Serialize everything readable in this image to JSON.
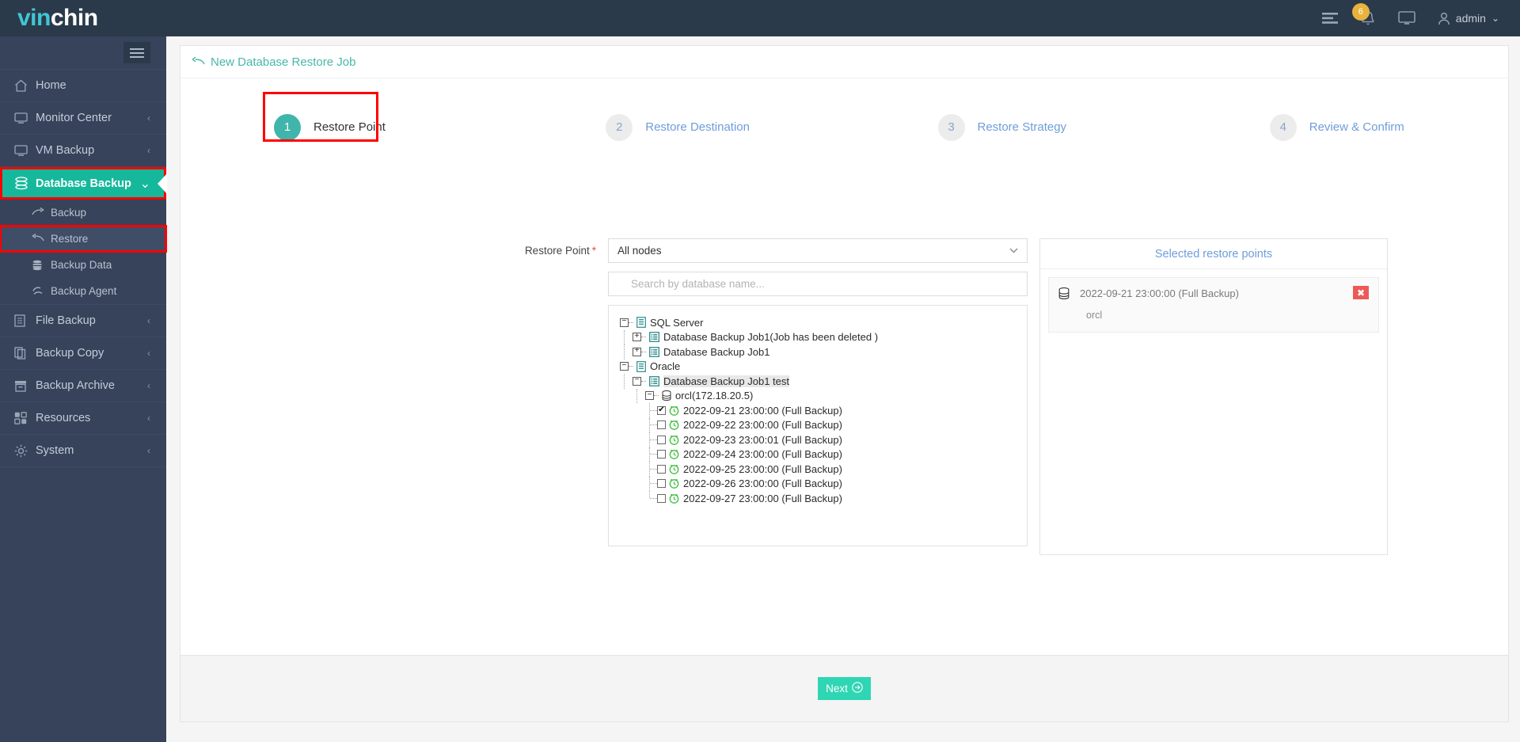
{
  "brand": {
    "part1": "vin",
    "part2": "chin"
  },
  "topbar": {
    "list_icon": "list-icon",
    "notifications_count": "6",
    "bell_icon": "bell-icon",
    "monitor_icon": "monitor-icon",
    "user_icon": "user-icon",
    "username": "admin",
    "caret": "⌄"
  },
  "sidebar": {
    "collapse_icon": "hamburger-icon",
    "items": [
      {
        "label": "Home",
        "icon": "home-icon",
        "chevron": ""
      },
      {
        "label": "Monitor Center",
        "icon": "monitor-icon",
        "chevron": "‹"
      },
      {
        "label": "VM Backup",
        "icon": "display-icon",
        "chevron": "‹"
      },
      {
        "label": "Database Backup",
        "icon": "database-icon",
        "chevron": "⌄"
      },
      {
        "label": "File Backup",
        "icon": "file-icon",
        "chevron": "‹"
      },
      {
        "label": "Backup Copy",
        "icon": "copy-icon",
        "chevron": "‹"
      },
      {
        "label": "Backup Archive",
        "icon": "archive-icon",
        "chevron": "‹"
      },
      {
        "label": "Resources",
        "icon": "grid-icon",
        "chevron": "‹"
      },
      {
        "label": "System",
        "icon": "gear-icon",
        "chevron": "‹"
      }
    ],
    "subitems": [
      {
        "label": "Backup",
        "icon": "backup-arrow-icon"
      },
      {
        "label": "Restore",
        "icon": "restore-arrow-icon"
      },
      {
        "label": "Backup Data",
        "icon": "database-stack-icon"
      },
      {
        "label": "Backup Agent",
        "icon": "agent-icon"
      }
    ]
  },
  "breadcrumb": {
    "back_icon": "back-arrow-icon",
    "title": "New Database Restore Job"
  },
  "steps": [
    {
      "num": "1",
      "label": "Restore Point"
    },
    {
      "num": "2",
      "label": "Restore Destination"
    },
    {
      "num": "3",
      "label": "Restore Strategy"
    },
    {
      "num": "4",
      "label": "Review & Confirm"
    }
  ],
  "form": {
    "restore_point_label": "Restore Point",
    "required_mark": "*",
    "node_select_value": "All nodes",
    "node_select_chevron": "⌄",
    "search_placeholder": "Search by database name...",
    "search_value": ""
  },
  "tree": [
    {
      "depth": 0,
      "toggler": "−",
      "icon": "server-icon",
      "label": "SQL Server",
      "checkbox": false,
      "highlight": false
    },
    {
      "depth": 1,
      "toggler": "+",
      "icon": "job-list-icon",
      "label": "Database Backup Job1(Job has been deleted )",
      "checkbox": false,
      "highlight": false
    },
    {
      "depth": 1,
      "toggler": "+",
      "icon": "job-list-icon",
      "label": "Database Backup Job1",
      "checkbox": false,
      "highlight": false
    },
    {
      "depth": 0,
      "toggler": "−",
      "icon": "server-icon",
      "label": "Oracle",
      "checkbox": false,
      "highlight": false
    },
    {
      "depth": 1,
      "toggler": "−",
      "icon": "job-list-icon",
      "label": "Database Backup Job1 test",
      "checkbox": false,
      "highlight": true
    },
    {
      "depth": 2,
      "toggler": "−",
      "icon": "database-icon",
      "label": "orcl(172.18.20.5)",
      "checkbox": false,
      "highlight": false
    },
    {
      "depth": 3,
      "toggler": null,
      "icon": "clock-icon",
      "label": "2022-09-21 23:00:00 (Full Backup)",
      "checkbox": true,
      "checked": true,
      "highlight": false
    },
    {
      "depth": 3,
      "toggler": null,
      "icon": "clock-icon",
      "label": "2022-09-22 23:00:00 (Full Backup)",
      "checkbox": true,
      "checked": false,
      "highlight": false
    },
    {
      "depth": 3,
      "toggler": null,
      "icon": "clock-icon",
      "label": "2022-09-23 23:00:01 (Full Backup)",
      "checkbox": true,
      "checked": false,
      "highlight": false
    },
    {
      "depth": 3,
      "toggler": null,
      "icon": "clock-icon",
      "label": "2022-09-24 23:00:00 (Full Backup)",
      "checkbox": true,
      "checked": false,
      "highlight": false
    },
    {
      "depth": 3,
      "toggler": null,
      "icon": "clock-icon",
      "label": "2022-09-25 23:00:00 (Full Backup)",
      "checkbox": true,
      "checked": false,
      "highlight": false
    },
    {
      "depth": 3,
      "toggler": null,
      "icon": "clock-icon",
      "label": "2022-09-26 23:00:00 (Full Backup)",
      "checkbox": true,
      "checked": false,
      "highlight": false
    },
    {
      "depth": 3,
      "toggler": null,
      "icon": "clock-icon",
      "label": "2022-09-27 23:00:00 (Full Backup)",
      "checkbox": true,
      "checked": false,
      "highlight": false
    }
  ],
  "selected_panel": {
    "title": "Selected restore points",
    "items": [
      {
        "icon": "database-icon",
        "title": "2022-09-21 23:00:00 (Full Backup)",
        "subtitle": "orcl",
        "delete_icon": "close-x-icon"
      }
    ]
  },
  "footer": {
    "next_label": "Next",
    "next_icon": "arrow-right-circle-icon"
  },
  "colors": {
    "accent": "#16b89c",
    "next_button": "#2fd6b4",
    "step_active": "#3fb5ac",
    "link_blue": "#6f9ddb",
    "highlight_red": "#fe0000",
    "badge_yellow": "#e8b33c",
    "delete_red": "#ec5a58",
    "sidebar_bg": "#36435a",
    "topbar_bg": "#2b3a4a"
  }
}
